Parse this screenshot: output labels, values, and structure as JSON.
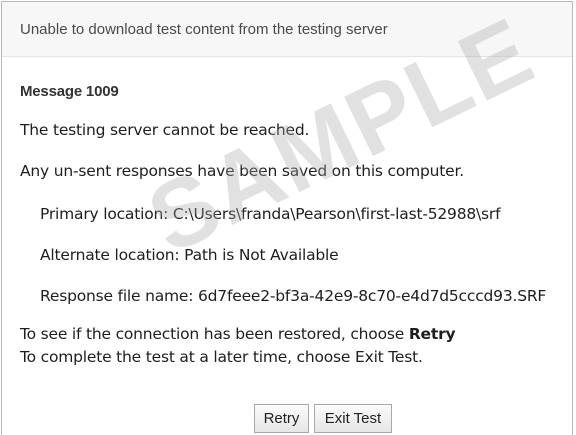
{
  "dialog": {
    "title": "Unable to download test content from the testing server",
    "message_title": "Message 1009",
    "lines": [
      "The testing server cannot be reached.",
      "Any un-sent responses have been saved on this computer.",
      "Primary location: C:\\Users\\franda\\Pearson\\first-last-52988\\srf",
      "Alternate location: Path is Not Available",
      "Response file name: 6d7feee2-bf3a-42e9-8c70-e4d7d5cccd93.SRF"
    ],
    "retry_instruction_prefix": "To see if the connection has been restored, choose ",
    "retry_instruction_bold": "Retry",
    "exit_instruction": "To complete the test at a later time, choose Exit Test."
  },
  "watermark": "SAMPLE",
  "buttons": {
    "retry_label": "Retry",
    "exit_label": "Exit Test"
  }
}
